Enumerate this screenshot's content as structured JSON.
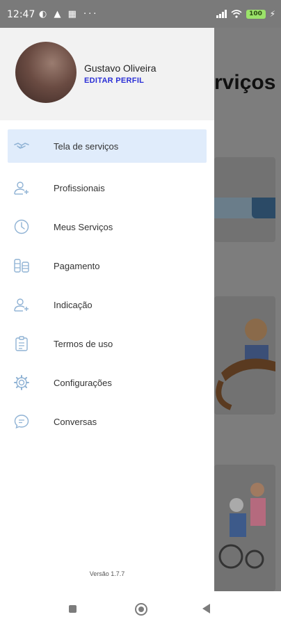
{
  "status_bar": {
    "time": "12:47",
    "left_icons": "◐ ▲ ▦  ···",
    "battery": "100"
  },
  "background_screen": {
    "title": "rviços"
  },
  "drawer": {
    "user_name": "Gustavo Oliveira",
    "edit_profile_label": "EDITAR PERFIL",
    "menu": [
      {
        "label": "Tela de serviços",
        "icon": "handshake-icon",
        "active": true
      },
      {
        "label": "Profissionais",
        "icon": "add-user-icon",
        "active": false
      },
      {
        "label": "Meus Serviços",
        "icon": "clock-icon",
        "active": false
      },
      {
        "label": "Pagamento",
        "icon": "coins-icon",
        "active": false
      },
      {
        "label": "Indicação",
        "icon": "add-user-icon",
        "active": false
      },
      {
        "label": "Termos de uso",
        "icon": "clipboard-icon",
        "active": false
      },
      {
        "label": "Configurações",
        "icon": "gear-icon",
        "active": false
      },
      {
        "label": "Conversas",
        "icon": "chat-bubble-icon",
        "active": false
      }
    ],
    "version": "Versão 1.7.7"
  },
  "colors": {
    "accent": "#2b2fd6",
    "active_item_bg": "#e0ecfb",
    "icon": "#8fb2d4"
  }
}
